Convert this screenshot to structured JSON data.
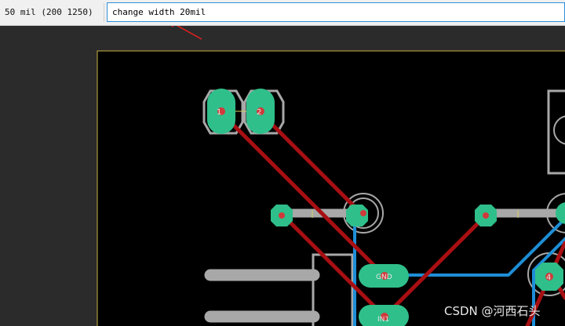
{
  "status_bar": {
    "grid_text": "50 mil (200 1250)"
  },
  "command_line": {
    "value": "change width 20mil"
  },
  "pads": {
    "p1": "1",
    "p2": "2",
    "gnd": "GND",
    "in1": "IN1",
    "p4": "4"
  },
  "watermark": "CSDN @河西石头",
  "colors": {
    "board_background": "#000000",
    "board_outline": "#c8b040",
    "pad": "#2fbf8a",
    "top_trace": "#a80f12",
    "bottom_trace": "#1e8ed6",
    "silkscreen": "#a8a8a8",
    "input_focus": "#2f8fd8",
    "annotation_arrow": "#e02020"
  }
}
